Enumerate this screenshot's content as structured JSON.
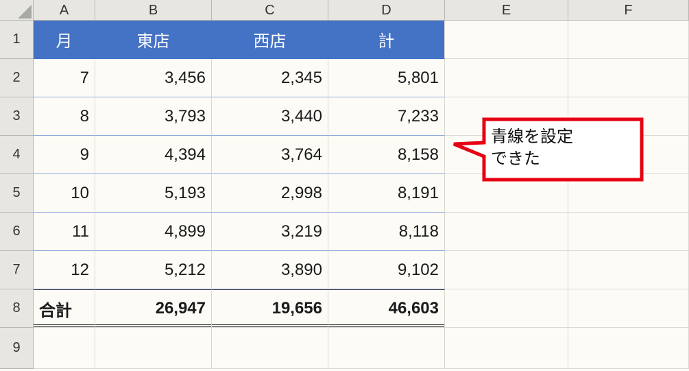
{
  "columns": [
    "A",
    "B",
    "C",
    "D",
    "E",
    "F"
  ],
  "row_numbers": [
    "1",
    "2",
    "3",
    "4",
    "5",
    "6",
    "7",
    "8",
    "9"
  ],
  "header": {
    "month": "月",
    "east": "東店",
    "west": "西店",
    "total": "計"
  },
  "rows": [
    {
      "month": "7",
      "east": "3,456",
      "west": "2,345",
      "total": "5,801"
    },
    {
      "month": "8",
      "east": "3,793",
      "west": "3,440",
      "total": "7,233"
    },
    {
      "month": "9",
      "east": "4,394",
      "west": "3,764",
      "total": "8,158"
    },
    {
      "month": "10",
      "east": "5,193",
      "west": "2,998",
      "total": "8,191"
    },
    {
      "month": "11",
      "east": "4,899",
      "west": "3,219",
      "total": "8,118"
    },
    {
      "month": "12",
      "east": "5,212",
      "west": "3,890",
      "total": "9,102"
    }
  ],
  "totals": {
    "label": "合計",
    "east": "26,947",
    "west": "19,656",
    "total": "46,603"
  },
  "callout": {
    "line1": "青線を設定",
    "line2": "できた"
  },
  "icons": {
    "select_all": "select-all-triangle"
  }
}
